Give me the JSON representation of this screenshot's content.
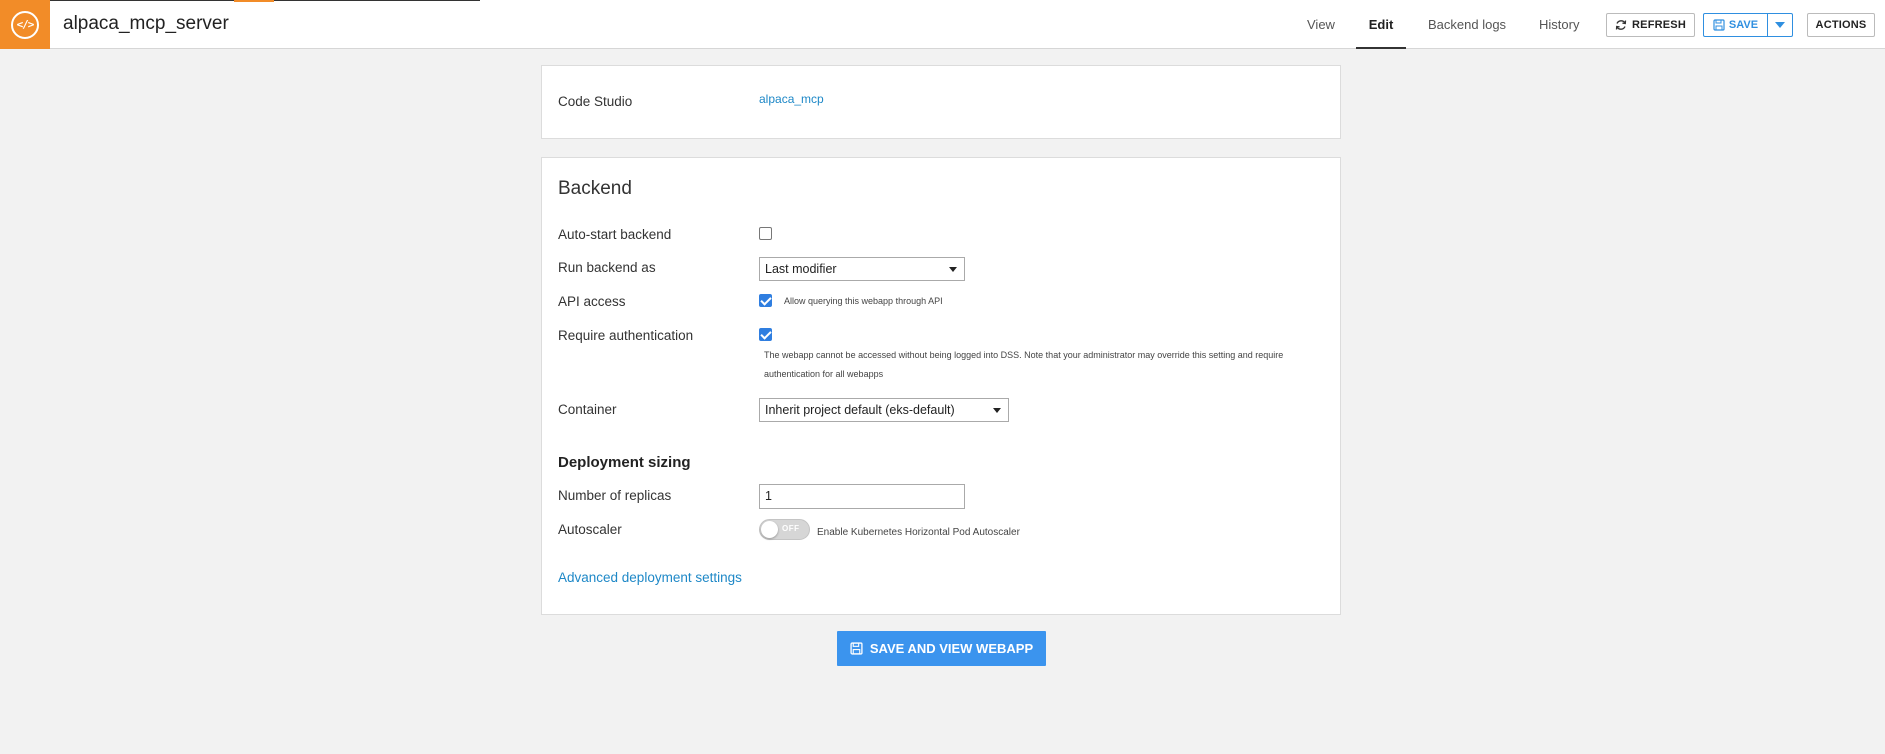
{
  "app": {
    "title": "alpaca_mcp_server",
    "logo_icon": "code-studio-icon"
  },
  "nav": {
    "tabs": [
      {
        "label": "View"
      },
      {
        "label": "Edit",
        "active": true
      },
      {
        "label": "Backend logs"
      },
      {
        "label": "History"
      }
    ],
    "refresh_label": "REFRESH",
    "save_label": "SAVE",
    "actions_label": "ACTIONS"
  },
  "code_studio": {
    "label": "Code Studio",
    "value": "alpaca_mcp"
  },
  "backend": {
    "title": "Backend",
    "auto_start": {
      "label": "Auto-start backend",
      "checked": false
    },
    "run_as": {
      "label": "Run backend as",
      "value": "Last modifier"
    },
    "api_access": {
      "label": "API access",
      "checked": true,
      "note": "Allow querying this webapp through API"
    },
    "require_auth": {
      "label": "Require authentication",
      "checked": true,
      "note_line1": "The webapp cannot be accessed without being logged into DSS. Note that your administrator may override this setting and require",
      "note_line2": "authentication for all webapps"
    },
    "container": {
      "label": "Container",
      "value": "Inherit project default (eks-default)"
    }
  },
  "deployment": {
    "title": "Deployment sizing",
    "replicas": {
      "label": "Number of replicas",
      "value": "1"
    },
    "autoscaler": {
      "label": "Autoscaler",
      "state": "OFF",
      "note": "Enable Kubernetes Horizontal Pod Autoscaler"
    },
    "advanced_link": "Advanced deployment settings"
  },
  "footer": {
    "save_view_label": "SAVE AND VIEW WEBAPP"
  },
  "colors": {
    "brand": "#f28c28",
    "accent": "#3b94ee",
    "link": "#1e88c7"
  }
}
